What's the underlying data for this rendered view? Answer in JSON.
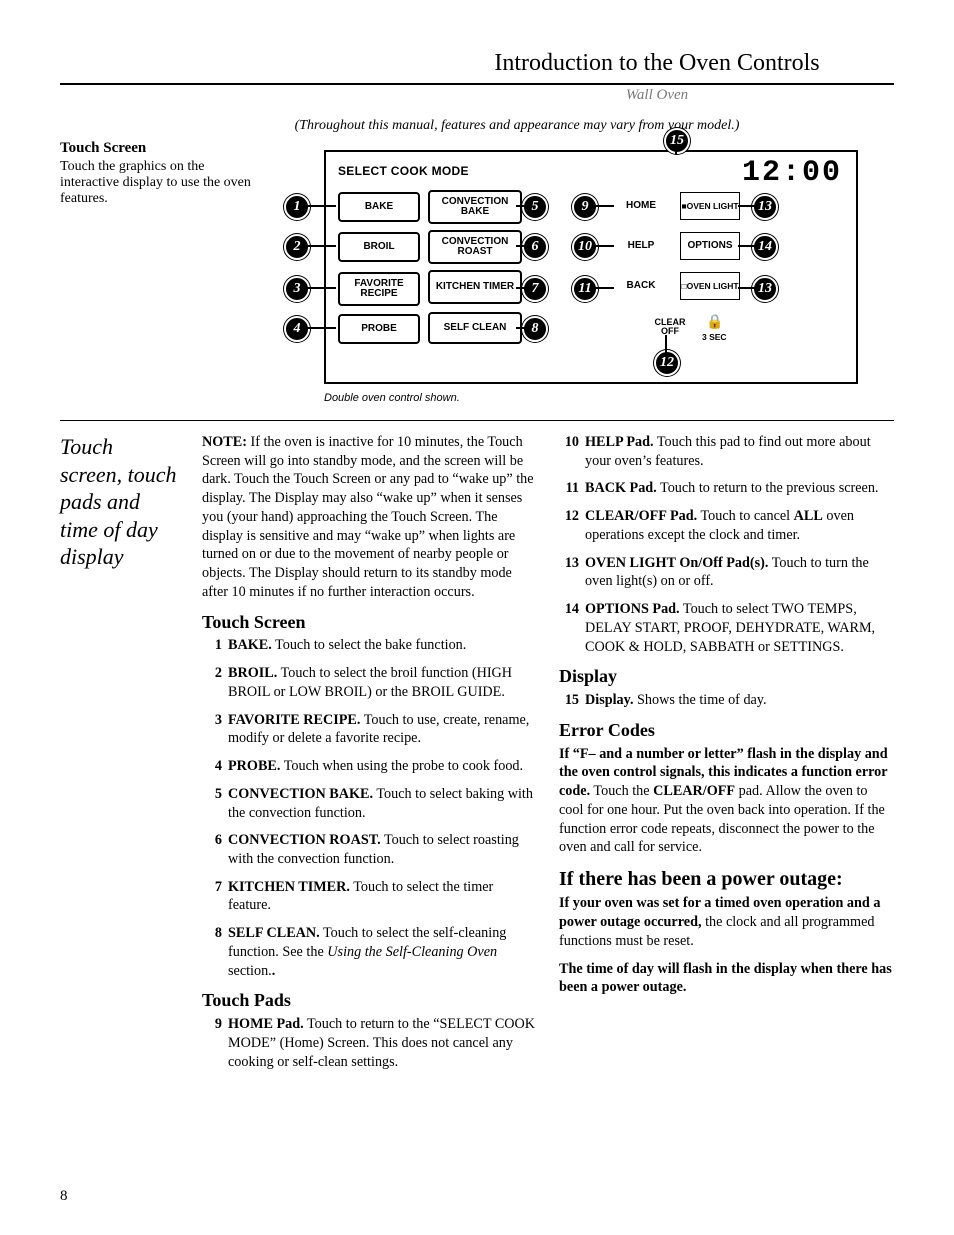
{
  "header": {
    "title": "Introduction to the Oven Controls",
    "subtitle": "Wall Oven",
    "variance_note": "(Throughout this manual, features and appearance may vary from your model.)"
  },
  "intro": {
    "heading": "Touch Screen",
    "text": "Touch the graphics on the interactive display to use the oven features."
  },
  "diagram": {
    "select_title": "SELECT COOK MODE",
    "clock": "12:00",
    "caption": "Double oven control shown.",
    "buttons": {
      "bake": "BAKE",
      "broil": "BROIL",
      "favorite": "FAVORITE RECIPE",
      "probe": "PROBE",
      "conv_bake": "CONVECTION BAKE",
      "conv_roast": "CONVECTION ROAST",
      "kitchen_timer": "KITCHEN TIMER",
      "self_clean": "SELF CLEAN",
      "home": "HOME",
      "help": "HELP",
      "back": "BACK",
      "clear_off": "CLEAR OFF",
      "oven_light_upper": "OVEN LIGHT",
      "options": "OPTIONS",
      "oven_light_lower": "OVEN LIGHT",
      "lock_time": "3 SEC"
    },
    "callouts": [
      "1",
      "2",
      "3",
      "4",
      "5",
      "6",
      "7",
      "8",
      "9",
      "10",
      "11",
      "12",
      "13",
      "13",
      "14",
      "15"
    ]
  },
  "sidehead": "Touch screen, touch pads and time of day display",
  "note_paragraph": {
    "lead": "NOTE:",
    "text": " If the oven is inactive for 10 minutes, the Touch Screen will go into standby mode, and the screen will be dark. Touch the Touch Screen or any pad to “wake up” the display. The Display may also “wake up” when it senses you (your hand) approaching the Touch Screen. The display is sensitive and may “wake up” when lights are turned on or due to the movement of nearby people or objects. The Display should return to its standby mode after 10 minutes if no further interaction occurs."
  },
  "sections": {
    "touch_screen_h": "Touch Screen",
    "touch_pads_h": "Touch Pads",
    "display_h": "Display",
    "error_h": "Error Codes",
    "outage_h": "If there has been a power outage:"
  },
  "items": {
    "i1": {
      "n": "1",
      "b": "BAKE.",
      "t": " Touch to select the bake function."
    },
    "i2": {
      "n": "2",
      "b": "BROIL.",
      "t": " Touch to select the broil function (HIGH BROIL or LOW BROIL) or the BROIL GUIDE."
    },
    "i3": {
      "n": "3",
      "b": "FAVORITE RECIPE.",
      "t": " Touch to use, create, rename, modify or delete a favorite recipe."
    },
    "i4": {
      "n": "4",
      "b": "PROBE.",
      "t": " Touch when using the probe to cook food."
    },
    "i5": {
      "n": "5",
      "b": "CONVECTION BAKE.",
      "t": " Touch to select baking with the convection function."
    },
    "i6": {
      "n": "6",
      "b": "CONVECTION ROAST.",
      "t": " Touch to select roasting with the convection function."
    },
    "i7": {
      "n": "7",
      "b": "KITCHEN TIMER.",
      "t": " Touch to select the timer feature."
    },
    "i8": {
      "n": "8",
      "b": "SELF CLEAN.",
      "t": " Touch to select the self-cleaning function. See the ",
      "it": "Using the Self-Cleaning Oven",
      "t2": " section."
    },
    "i9": {
      "n": "9",
      "b": "HOME Pad.",
      "t": " Touch to return to the “SELECT COOK MODE” (Home) Screen. This does not cancel any cooking or self-clean settings."
    },
    "i10": {
      "n": "10",
      "b": "HELP Pad.",
      "t": " Touch this pad to find out more about your oven’s features."
    },
    "i11": {
      "n": "11",
      "b": "BACK Pad.",
      "t": " Touch to return to the previous screen."
    },
    "i12": {
      "n": "12",
      "b": "CLEAR/OFF Pad.",
      "t": " Touch to cancel ",
      "b2": "ALL",
      "t2": " oven operations except the clock and timer."
    },
    "i13": {
      "n": "13",
      "b": "OVEN LIGHT On/Off Pad(s).",
      "t": " Touch to turn the oven light(s) on or off."
    },
    "i14": {
      "n": "14",
      "b": "OPTIONS Pad.",
      "t": " Touch to select TWO TEMPS, DELAY START, PROOF, DEHYDRATE, WARM, COOK & HOLD, SABBATH or SETTINGS."
    },
    "i15": {
      "n": "15",
      "b": "Display.",
      "t": " Shows the time of day."
    }
  },
  "error_text": {
    "b1": "If “F– and a number or letter” flash in the display and the oven control signals, this indicates a function error code.",
    "t1": " Touch the ",
    "b2": "CLEAR/OFF",
    "t2": " pad. Allow the oven to cool for one hour. Put the oven back into operation. If the function error code repeats, disconnect the power to the oven and call for service."
  },
  "outage": {
    "p1b": "If your oven was set for a timed oven operation and a power outage occurred,",
    "p1t": " the clock and all programmed functions must be reset.",
    "p2": "The time of day will flash in the display when there has been a power outage."
  },
  "page_number": "8"
}
